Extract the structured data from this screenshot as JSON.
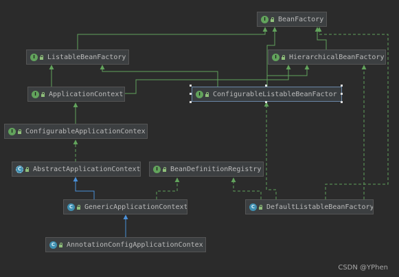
{
  "diagram": {
    "nodes": {
      "bean_factory": {
        "name": "BeanFactory",
        "kind": "interface",
        "badge": "I"
      },
      "listable_bean_factory": {
        "name": "ListableBeanFactory",
        "kind": "interface",
        "badge": "I"
      },
      "hierarchical_bean_factory": {
        "name": "HierarchicalBeanFactory",
        "kind": "interface",
        "badge": "I"
      },
      "application_context": {
        "name": "ApplicationContext",
        "kind": "interface",
        "badge": "I"
      },
      "configurable_listable_bean_factory": {
        "name": "ConfigurableListableBeanFactor",
        "kind": "interface",
        "badge": "I"
      },
      "configurable_application_context": {
        "name": "ConfigurableApplicationContex",
        "kind": "interface",
        "badge": "I"
      },
      "abstract_application_context": {
        "name": "AbstractApplicationContext",
        "kind": "abstract",
        "badge": "C"
      },
      "bean_definition_registry": {
        "name": "BeanDefinitionRegistry",
        "kind": "interface",
        "badge": "I"
      },
      "generic_application_context": {
        "name": "GenericApplicationContext",
        "kind": "class",
        "badge": "C"
      },
      "default_listable_bean_factory": {
        "name": "DefaultListableBeanFactory",
        "kind": "class",
        "badge": "C"
      },
      "annotation_config_application_context": {
        "name": "AnnotationConfigApplicationContex",
        "kind": "class",
        "badge": "C"
      }
    },
    "colors": {
      "interface_extends": "#62a35c",
      "class_extends": "#4a90d9",
      "implements": "#62a35c",
      "background": "#2b2b2b"
    }
  },
  "watermark": "CSDN @YPhen"
}
